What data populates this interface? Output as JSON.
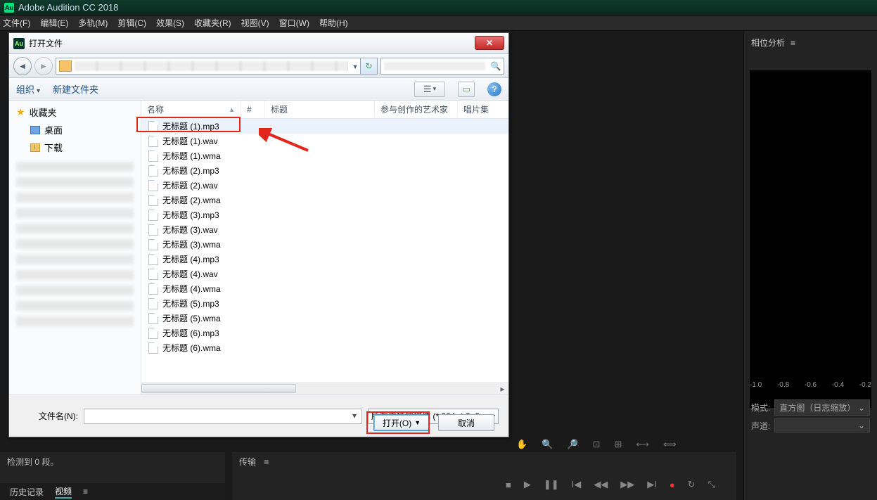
{
  "app": {
    "title": "Adobe Audition CC 2018",
    "icon": "Au"
  },
  "menu": [
    "文件(F)",
    "编辑(E)",
    "多轨(M)",
    "剪辑(C)",
    "效果(S)",
    "收藏夹(R)",
    "视图(V)",
    "窗口(W)",
    "帮助(H)"
  ],
  "right_panel": {
    "title": "相位分析",
    "scale": [
      "-1.0",
      "-0.8",
      "-0.6",
      "-0.4",
      "-0.2"
    ],
    "mode_label": "模式:",
    "mode_value": "直方图（日志缩放）",
    "channel_label": "声道:"
  },
  "left_bottom": {
    "status": "检测到 0 段。",
    "tabs": [
      "历史记录",
      "视频"
    ]
  },
  "transport": {
    "label": "传输"
  },
  "dialog": {
    "title": "打开文件",
    "close": "✕",
    "toolbar": {
      "organize": "组织",
      "newfolder": "新建文件夹",
      "help": "?"
    },
    "sidebar": {
      "favorites": "收藏夹",
      "desktop": "桌面",
      "downloads": "下载"
    },
    "columns": {
      "name": "名称",
      "num": "#",
      "title": "标题",
      "artist": "参与创作的艺术家",
      "album": "唱片集"
    },
    "files": [
      "无标题 (1).mp3",
      "无标题 (1).wav",
      "无标题 (1).wma",
      "无标题 (2).mp3",
      "无标题 (2).wav",
      "无标题 (2).wma",
      "无标题 (3).mp3",
      "无标题 (3).wav",
      "无标题 (3).wma",
      "无标题 (4).mp3",
      "无标题 (4).wav",
      "无标题 (4).wma",
      "无标题 (5).mp3",
      "无标题 (5).wma",
      "无标题 (6).mp3",
      "无标题 (6).wma"
    ],
    "footer": {
      "filename_label": "文件名(N):",
      "filetype": "所有支持的媒体 (*.264, *.3g2,",
      "open": "打开(O)",
      "cancel": "取消"
    }
  }
}
